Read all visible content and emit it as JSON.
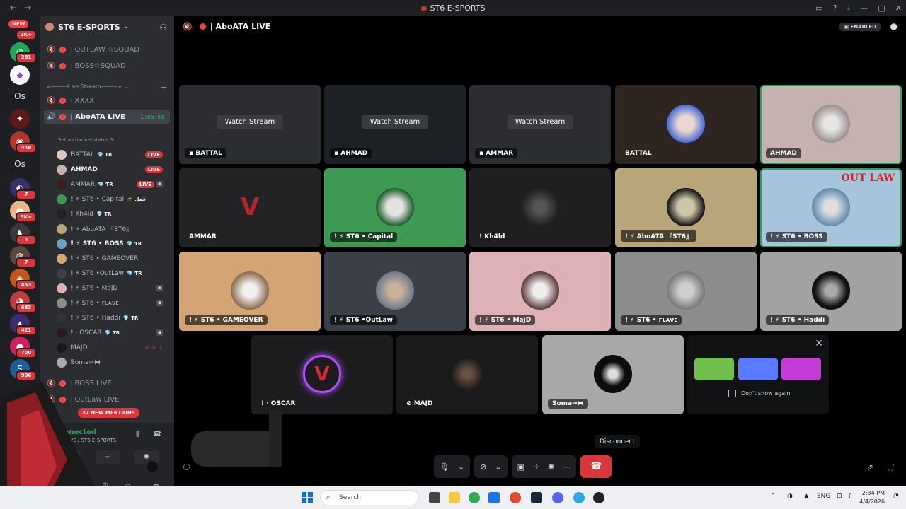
{
  "window": {
    "title": "ST6 E-SPORTS"
  },
  "rail": {
    "new_label": "NEW",
    "badges": [
      "2K+",
      "281",
      "7",
      "3K+",
      "4",
      "7",
      "453",
      "683",
      "421",
      "700",
      "906"
    ],
    "text_servers": [
      "Os",
      "Os"
    ]
  },
  "server": {
    "name": "ST6 E-SPORTS"
  },
  "channels_top": [
    {
      "name": "| OUTLAW ☆SQUAD"
    },
    {
      "name": "| BOSS☆SQUAD"
    }
  ],
  "category": {
    "label": "«———Live Stream———»"
  },
  "channels_stream": [
    {
      "name": "| XXXX"
    },
    {
      "name": "| AboATA LIVE",
      "time": "1:05:58",
      "status": "Set a channel status"
    }
  ],
  "members": [
    {
      "name": "BATTAL",
      "tag": "💎 ƬR",
      "live": "LIVE"
    },
    {
      "name": "AHMAD",
      "live": "LIVE"
    },
    {
      "name": "AMMAR",
      "tag": "💎 ƬR",
      "live": "LIVE"
    },
    {
      "name": "! ⚡ ST6 • Capital",
      "tag": "🥷 قمل"
    },
    {
      "name": "! Kh4ld",
      "tag": "💎 ƬR"
    },
    {
      "name": "! ⚡ AboATA 『ST6』"
    },
    {
      "name": "! ⚡ ST6 • BOSS",
      "tag": "💎 ƬR"
    },
    {
      "name": "! ⚡ ST6 • GAMEOVER"
    },
    {
      "name": "! ⚡ ST6 •OutLaw",
      "tag": "💎 ƬR"
    },
    {
      "name": "! ⚡ ST6 • MajD"
    },
    {
      "name": "! ⚡ ST6 • ꜰʟᴀᴠᴇ"
    },
    {
      "name": "! ⚡ ST6 • Haddi",
      "tag": "💎 ƬR"
    },
    {
      "name": "! · OSCAR",
      "tag": "💎 ƬR"
    },
    {
      "name": "MAJD"
    },
    {
      "name": "Soma→⧓"
    }
  ],
  "channels_bottom": [
    {
      "name": "| BOSS LIVE"
    },
    {
      "name": "| OutLaw LIVE"
    }
  ],
  "mentions": "37 NEW MENTIONS",
  "voice": {
    "connected": "ce Connected",
    "location": "AboATA LIVE / ST6 E-SPORTS"
  },
  "main": {
    "channel": "| AboATA LIVE",
    "enabled": "ENABLED"
  },
  "tiles": [
    {
      "label": "BATTAL",
      "watch": "Watch Stream",
      "bg": "#2b2d31"
    },
    {
      "label": "AHMAD",
      "watch": "Watch Stream",
      "bg": "#1d2126"
    },
    {
      "label": "AMMAR",
      "watch": "Watch Stream",
      "bg": "#2b2d31"
    },
    {
      "label": "BATTAL",
      "bg": "#2e2420"
    },
    {
      "label": "AHMAD",
      "bg": "#c5b2b0"
    },
    {
      "label": "AMMAR",
      "bg": "#232325"
    },
    {
      "label": "! ⚡ ST6 • Capital",
      "bg": "#3e9a52"
    },
    {
      "label": "! Kh4ld",
      "bg": "#1f1f21"
    },
    {
      "label": "! ⚡ AboATA 『ST6』",
      "bg": "#b9a57a"
    },
    {
      "label": "! ⚡ ST6 • BOSS",
      "bg": "#a6c4dc"
    },
    {
      "label": "! ⚡ ST6 • GAMEOVER",
      "bg": "#d4a574"
    },
    {
      "label": "! ⚡ ST6 •OutLaw",
      "bg": "#3b4048"
    },
    {
      "label": "! ⚡ ST6 • MajD",
      "bg": "#ddb1b6"
    },
    {
      "label": "! ⚡ ST6 • ꜰʟᴀᴠᴇ",
      "bg": "#8c8c8c"
    },
    {
      "label": "! ⚡ ST6 • Haddi",
      "bg": "#a2a2a2"
    },
    {
      "label": "! · OSCAR",
      "bg": "#1c1c1e"
    },
    {
      "label": "MAJD",
      "bg": "#1a1a1a"
    },
    {
      "label": "Soma→⧓",
      "bg": "#a8a8a8"
    }
  ],
  "promo": {
    "dont_show": "Don't show again"
  },
  "tooltip": "Disconnect",
  "taskbar": {
    "search": "Search",
    "lang": "ENG",
    "time": "2:34 PM",
    "date": "4/4/2026"
  },
  "colors": {
    "accent": "#5865f2",
    "live": "#da373c",
    "connected": "#23a55a"
  }
}
